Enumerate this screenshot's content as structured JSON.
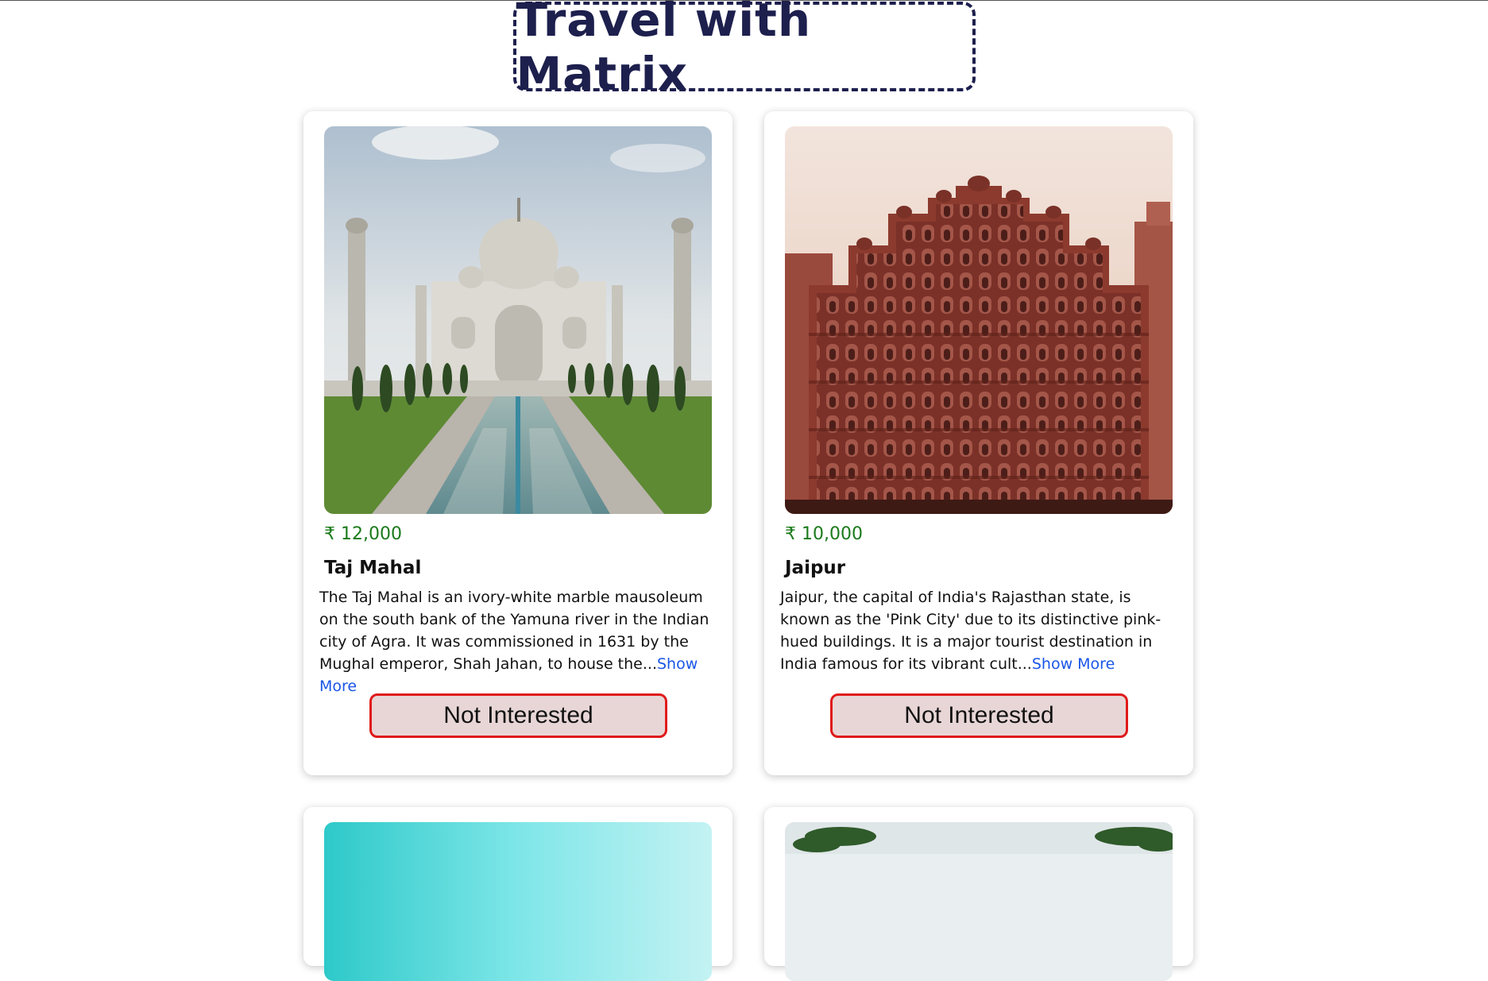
{
  "header": {
    "title": "Travel with Matrix"
  },
  "cards": [
    {
      "price": "₹ 12,000",
      "name": "Taj Mahal",
      "description": "The Taj Mahal is an ivory-white marble mausoleum on the south bank of the Yamuna river in the Indian city of Agra. It was commissioned in 1631 by the Mughal emperor, Shah Jahan, to house the...",
      "show_more": "Show More",
      "button": "Not Interested"
    },
    {
      "price": "₹ 10,000",
      "name": "Jaipur",
      "description": "Jaipur, the capital of India's Rajasthan state, is known as the 'Pink City' due to its distinctive pink-hued buildings. It is a major tourist destination in India famous for its vibrant cult...",
      "show_more": "Show More",
      "button": "Not Interested"
    }
  ],
  "colors": {
    "title": "#1d1f4d",
    "price": "#1a7a1a",
    "link": "#1a56e6",
    "button_border": "#e01a1a",
    "button_bg": "#e8d6d6"
  }
}
